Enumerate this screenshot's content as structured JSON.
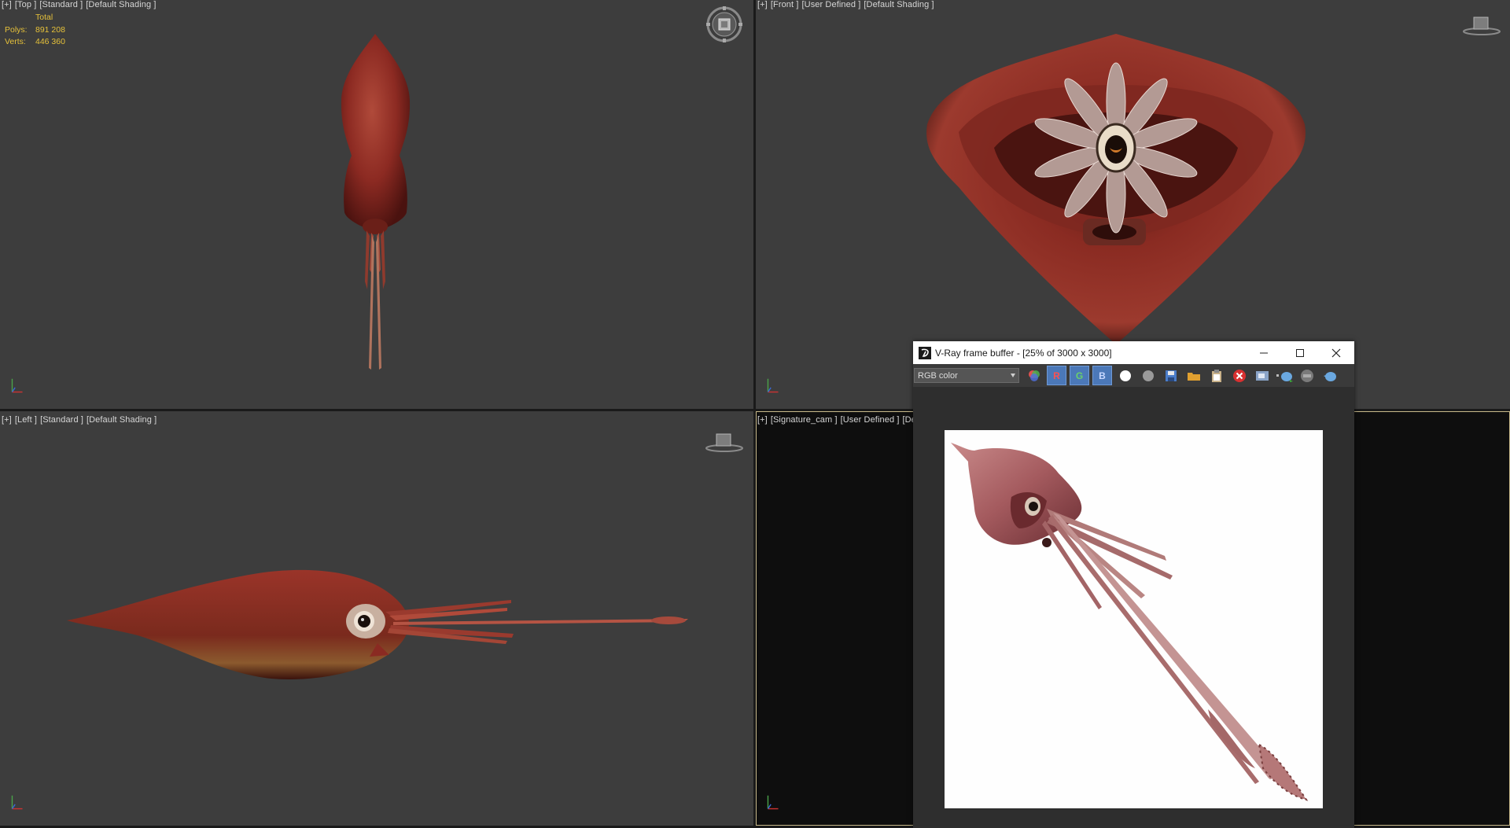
{
  "viewports": {
    "top": {
      "label_parts": [
        "[+]",
        "[Top ]",
        "[Standard ]",
        "[Default Shading ]"
      ],
      "stats": {
        "title": "Total",
        "polys_label": "Polys:",
        "polys_value": "891 208",
        "verts_label": "Verts:",
        "verts_value": "446 360"
      }
    },
    "front": {
      "label_parts": [
        "[+]",
        "[Front ]",
        "[User Defined ]",
        "[Default Shading ]"
      ]
    },
    "left": {
      "label_parts": [
        "[+]",
        "[Left ]",
        "[Standard ]",
        "[Default Shading ]"
      ]
    },
    "camera": {
      "label_parts": [
        "[+]",
        "[Signature_cam ]",
        "[User Defined ]",
        "[De"
      ]
    }
  },
  "vfb": {
    "title": "V-Ray frame buffer - [25% of 3000 x 3000]",
    "channel_select": "RGB color",
    "channel_r": "R",
    "channel_g": "G",
    "channel_b": "B"
  },
  "colors": {
    "viewport_bg": "#3d3d3d",
    "stats_text": "#e6c13a",
    "squid_red": "#8c2a22",
    "active_border": "#c8b98a"
  },
  "icons": [
    "viewcube-icon",
    "axis-tripod-icon",
    "vray-logo-icon",
    "minimize-icon",
    "maximize-icon",
    "close-icon",
    "color-corrections-icon",
    "white-dot-icon",
    "gray-dot-icon",
    "save-icon",
    "open-icon",
    "clipboard-icon",
    "clear-icon",
    "region-icon",
    "render-teapot-icon",
    "stop-icon",
    "render-interactive-icon"
  ]
}
